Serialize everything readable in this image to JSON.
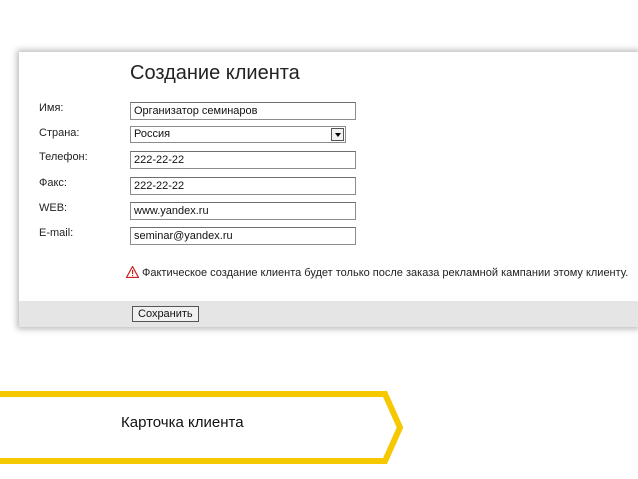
{
  "form": {
    "title": "Создание клиента",
    "fields": [
      {
        "label": "Имя:",
        "value": "Организатор семинаров"
      },
      {
        "label": "Страна:",
        "value": "Россия"
      },
      {
        "label": "Телефон:",
        "value": "222-22-22"
      },
      {
        "label": "Факс:",
        "value": "222-22-22"
      },
      {
        "label": "WEB:",
        "value": "www.yandex.ru"
      },
      {
        "label": "E-mail:",
        "value": "seminar@yandex.ru"
      }
    ],
    "warning": "Фактическое создание клиента будет только после заказа рекламной кампании этому клиенту.",
    "save_label": "Сохранить"
  },
  "caption": "Карточка клиента",
  "colors": {
    "banner_stroke": "#f5c800",
    "warning_icon": "#cc1f1f",
    "footer_bg": "#e5e5e5"
  }
}
